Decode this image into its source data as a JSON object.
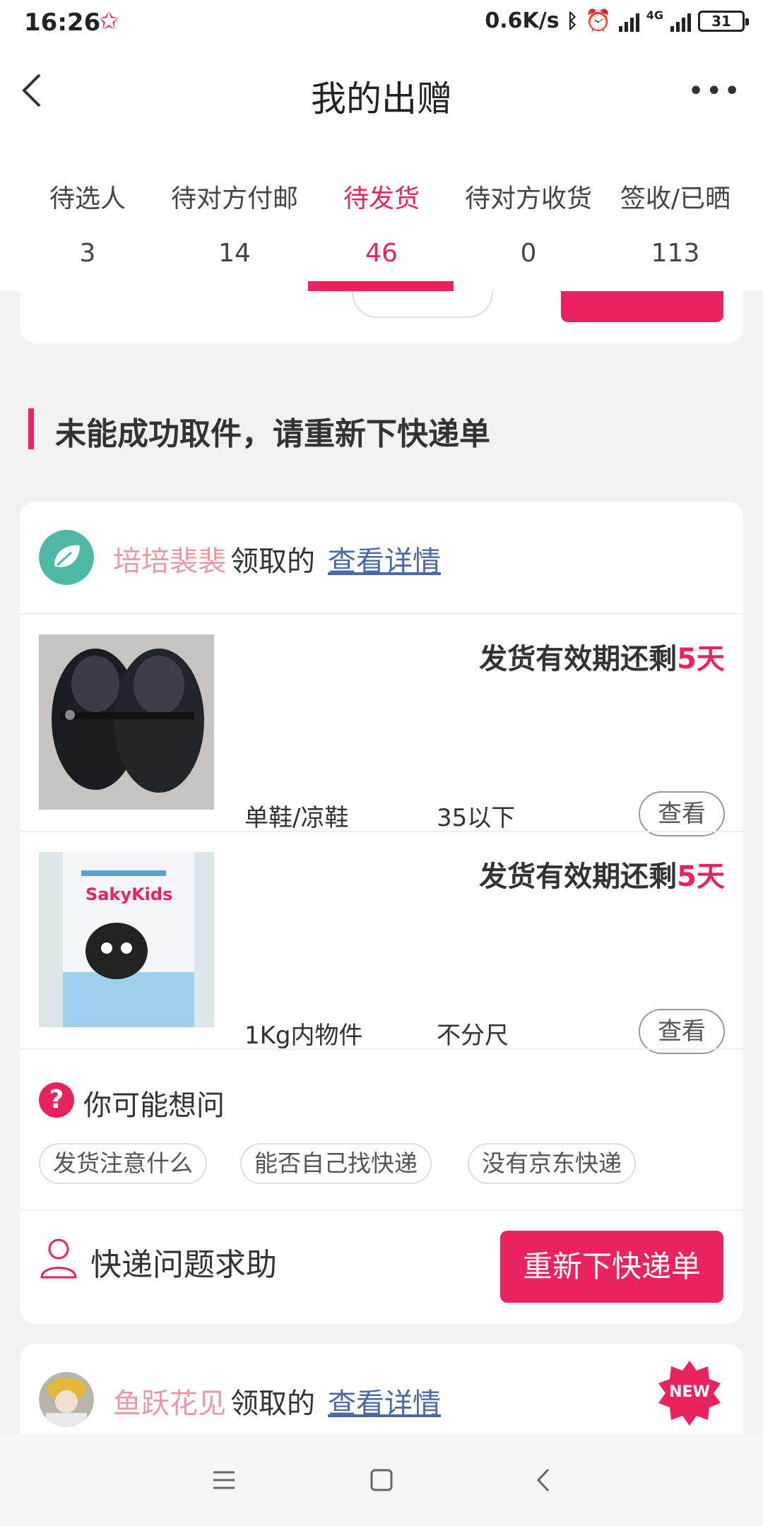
{
  "status": {
    "time": "16:26",
    "net_speed": "0.6K/s",
    "network": "4G",
    "battery": "31"
  },
  "header": {
    "title": "我的出赠"
  },
  "tabs": [
    {
      "label": "待选人",
      "count": "3"
    },
    {
      "label": "待对方付邮",
      "count": "14"
    },
    {
      "label": "待发货",
      "count": "46",
      "active": true
    },
    {
      "label": "待对方收货",
      "count": "0"
    },
    {
      "label": "签收/已晒",
      "count": "113"
    }
  ],
  "section": {
    "title": "未能成功取件，请重新下快递单"
  },
  "card1": {
    "user": "培培裴裴",
    "received_label": "领取的",
    "detail_link": "查看详情",
    "items": [
      {
        "deadline_prefix": "发货有效期还剩",
        "days": "5天",
        "category": "单鞋/凉鞋",
        "size": "35以下",
        "view": "查看",
        "image": "black-shoes"
      },
      {
        "deadline_prefix": "发货有效期还剩",
        "days": "5天",
        "category": "1Kg内物件",
        "size": "不分尺",
        "view": "查看",
        "image": "sakykids-toothpaste",
        "brand": "SakyKids"
      }
    ],
    "faq": {
      "title": "你可能想问",
      "chips": [
        "发货注意什么",
        "能否自己找快递",
        "没有京东快递"
      ]
    },
    "help_label": "快递问题求助",
    "reorder_button": "重新下快递单"
  },
  "card2": {
    "user": "鱼跃花见",
    "received_label": "领取的",
    "detail_link": "查看详情",
    "badge": "NEW"
  },
  "colors": {
    "accent": "#e8235d",
    "username": "#e99aa0",
    "link": "#4c6aa0"
  }
}
